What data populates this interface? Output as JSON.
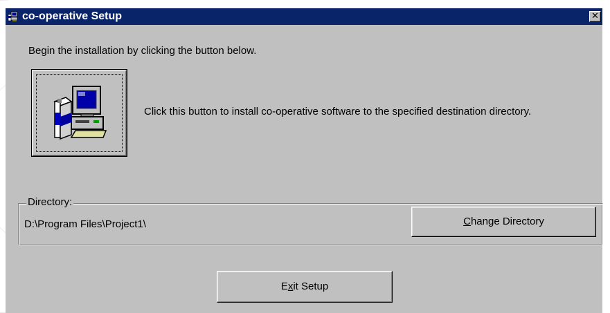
{
  "window": {
    "title": "co-operative Setup",
    "close_glyph": "✕",
    "icon": "setup-computer-icon"
  },
  "main": {
    "instruction": "Begin the installation by clicking the button below.",
    "install_button_icon": "install-computer-icon",
    "install_description": "Click this button to install co-operative software to the specified destination directory."
  },
  "directory": {
    "group_label": "Directory:",
    "path": "D:\\Program Files\\Project1\\",
    "change_button": {
      "mnemonic": "C",
      "rest": "hange Directory"
    }
  },
  "footer": {
    "exit_button": {
      "before": "E",
      "mnemonic": "x",
      "after": "it Setup"
    }
  },
  "colors": {
    "titlebar": "#0a246a",
    "face": "#c0c0c0"
  }
}
